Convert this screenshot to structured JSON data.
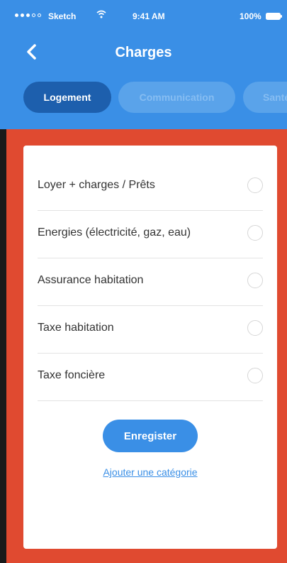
{
  "status_bar": {
    "carrier": "Sketch",
    "time": "9:41 AM",
    "battery": "100%",
    "signal_icon": "signal-dots-icon",
    "wifi_icon": "wifi-icon",
    "battery_icon": "battery-icon"
  },
  "nav": {
    "title": "Charges",
    "back_icon": "chevron-left-icon"
  },
  "tabs": [
    {
      "label": "Logement",
      "active": true
    },
    {
      "label": "Communication",
      "active": false
    },
    {
      "label": "Santé",
      "active": false
    }
  ],
  "items": [
    {
      "label": "Loyer + charges / Prêts",
      "selected": false
    },
    {
      "label": "Energies (électricité, gaz, eau)",
      "selected": false
    },
    {
      "label": "Assurance habitation",
      "selected": false
    },
    {
      "label": "Taxe habitation",
      "selected": false
    },
    {
      "label": "Taxe foncière",
      "selected": false
    }
  ],
  "actions": {
    "save_label": "Enregister",
    "add_category_label": "Ajouter une catégorie"
  },
  "colors": {
    "header_blue": "#3a8fe6",
    "active_tab": "#1d5fad",
    "body_red": "#e04a30"
  }
}
